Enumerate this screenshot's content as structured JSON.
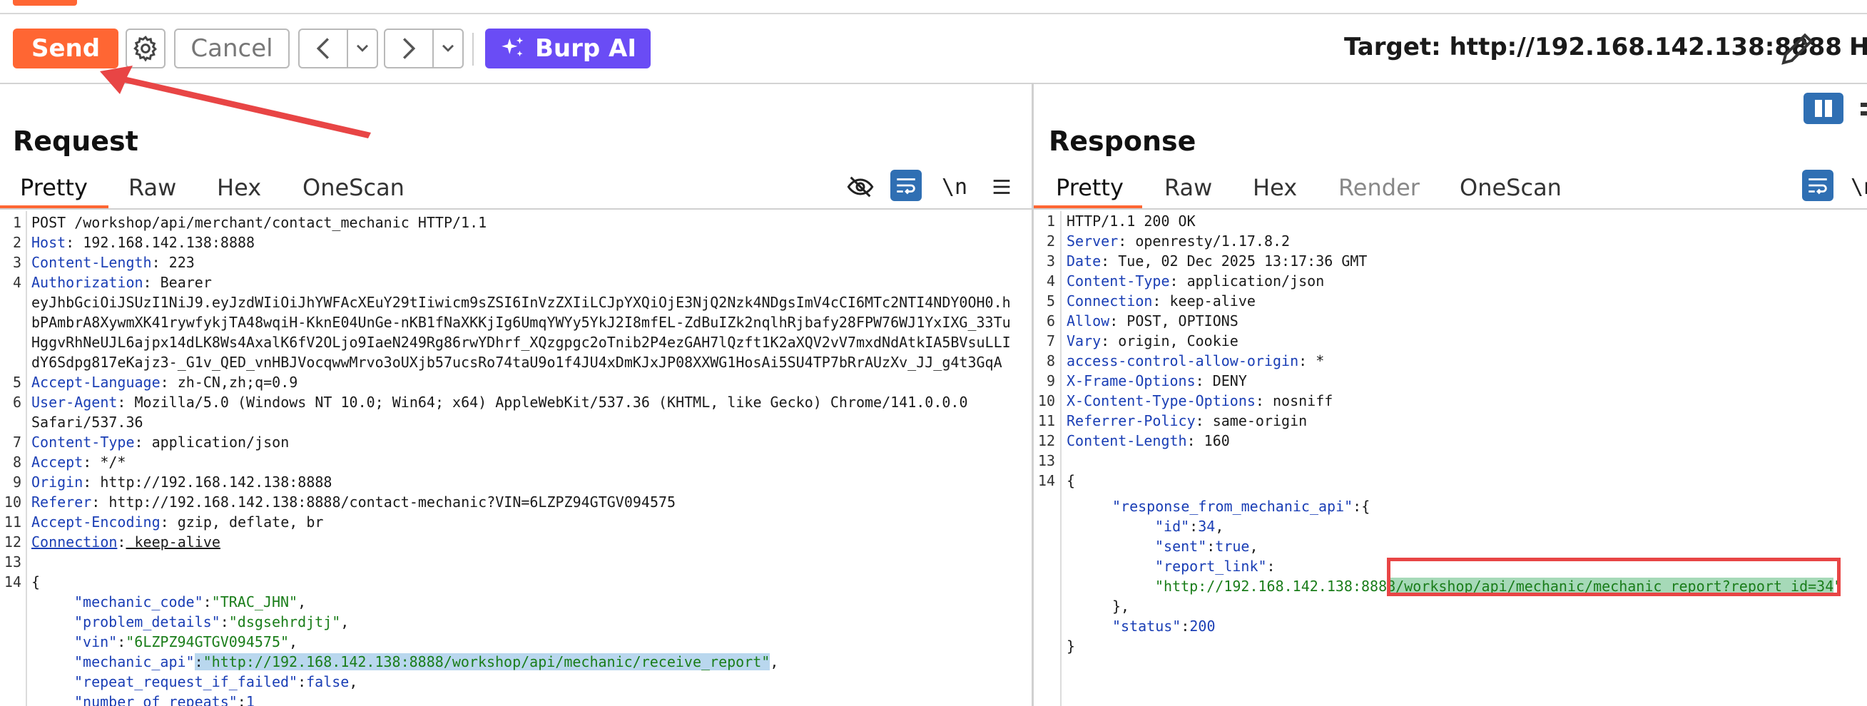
{
  "toolbar": {
    "send_label": "Send",
    "cancel_label": "Cancel",
    "burp_ai_label": "Burp AI",
    "target_label": "Target: http://192.168.142.138:8888",
    "clipped_label": "H"
  },
  "request": {
    "title": "Request",
    "tabs": [
      "Pretty",
      "Raw",
      "Hex",
      "OneScan"
    ],
    "active_tab": "Pretty",
    "lines": [
      {
        "n": "1",
        "text": "POST /workshop/api/merchant/contact_mechanic HTTP/1.1"
      },
      {
        "n": "2",
        "name": "Host",
        "value": " 192.168.142.138:8888"
      },
      {
        "n": "3",
        "name": "Content-Length",
        "value": " 223"
      },
      {
        "n": "4",
        "name": "Authorization",
        "value": " Bearer"
      },
      {
        "n": "",
        "text": "eyJhbGciOiJSUzI1NiJ9.eyJzdWIiOiJhYWFAcXEuY29tIiwicm9sZSI6InVzZXIiLCJpYXQiOjE3NjQ2Nzk4NDgsImV4cCI6MTc2NTI4NDY0OH0.h"
      },
      {
        "n": "",
        "text": "bPAmbrA8XywmXK41rywfykjTA48wqiH-KknE04UnGe-nKB1fNaXKKjIg6UmqYWYy5YkJ2I8mfEL-ZdBuIZk2nqlhRjbafy28FPW76WJ1YxIXG_33Tu"
      },
      {
        "n": "",
        "text": "HggvRhNeUJL6ajpx14dLK8Ws4AxalK6fV2OLjo9IaeN249Rg86rwYDhrf_XQzgpgc2oTnib2P4ezGAH7lQzft1K2aXQV2vV7mxdNdAtkIA5BVsuLLI"
      },
      {
        "n": "",
        "text": "dY6Sdpg817eKajz3-_G1v_QED_vnHBJVocqwwMrvo3oUXjb57ucsRo74taU9o1f4JU4xDmKJxJP08XXWG1HosAi5SU4TP7bRrAUzXv_JJ_g4t3GqA"
      },
      {
        "n": "5",
        "name": "Accept-Language",
        "value": " zh-CN,zh;q=0.9"
      },
      {
        "n": "6",
        "name": "User-Agent",
        "value": " Mozilla/5.0 (Windows NT 10.0; Win64; x64) AppleWebKit/537.36 (KHTML, like Gecko) Chrome/141.0.0.0"
      },
      {
        "n": "",
        "text": "Safari/537.36"
      },
      {
        "n": "7",
        "name": "Content-Type",
        "value": " application/json"
      },
      {
        "n": "8",
        "name": "Accept",
        "value": " */*"
      },
      {
        "n": "9",
        "name": "Origin",
        "value": " http://192.168.142.138:8888"
      },
      {
        "n": "10",
        "name": "Referer",
        "value": " http://192.168.142.138:8888/contact-mechanic?VIN=6LZPZ94GTGV094575"
      },
      {
        "n": "11",
        "name": "Accept-Encoding",
        "value": " gzip, deflate, br"
      },
      {
        "n": "12",
        "name": "Connection",
        "value": " keep-alive"
      },
      {
        "n": "13",
        "text": ""
      },
      {
        "n": "14",
        "text": "{"
      }
    ],
    "json": [
      {
        "key": "\"mechanic_code\"",
        "val": "\"TRAC_JHN\"",
        "type": "s",
        "tail": ","
      },
      {
        "key": "\"problem_details\"",
        "val": "\"dsgsehrdjtj\"",
        "type": "s",
        "tail": ","
      },
      {
        "key": "\"vin\"",
        "val": "\"6LZPZ94GTGV094575\"",
        "type": "s",
        "tail": ","
      },
      {
        "key": "\"mechanic_api\"",
        "val": "\"http://192.168.142.138:8888/workshop/api/mechanic/receive_report\"",
        "type": "s",
        "tail": ","
      },
      {
        "key": "\"repeat_request_if_failed\"",
        "val": "false",
        "type": "n",
        "tail": ","
      },
      {
        "key": "\"number_of_repeats\"",
        "val": "1",
        "type": "n",
        "tail": ""
      }
    ]
  },
  "response": {
    "title": "Response",
    "tabs": [
      "Pretty",
      "Raw",
      "Hex",
      "Render",
      "OneScan"
    ],
    "active_tab": "Pretty",
    "status_line": "HTTP/1.1 200 OK",
    "headers": [
      {
        "n": "2",
        "name": "Server",
        "value": " openresty/1.17.8.2"
      },
      {
        "n": "3",
        "name": "Date",
        "value": " Tue, 02 Dec 2025 13:17:36 GMT"
      },
      {
        "n": "4",
        "name": "Content-Type",
        "value": " application/json"
      },
      {
        "n": "5",
        "name": "Connection",
        "value": " keep-alive"
      },
      {
        "n": "6",
        "name": "Allow",
        "value": " POST, OPTIONS"
      },
      {
        "n": "7",
        "name": "Vary",
        "value": " origin, Cookie"
      },
      {
        "n": "8",
        "name": "access-control-allow-origin",
        "value": " *"
      },
      {
        "n": "9",
        "name": "X-Frame-Options",
        "value": " DENY"
      },
      {
        "n": "10",
        "name": "X-Content-Type-Options",
        "value": " nosniff"
      },
      {
        "n": "11",
        "name": "Referrer-Policy",
        "value": " same-origin"
      },
      {
        "n": "12",
        "name": "Content-Length",
        "value": " 160"
      }
    ],
    "line_13": "",
    "line_14": "{",
    "json": {
      "outer_key": "\"response_from_mechanic_api\"",
      "id_key": "\"id\"",
      "id_val": "34",
      "sent_key": "\"sent\"",
      "sent_val": "true",
      "report_key": "\"report_link\"",
      "report_val_a": "\"http://192.168.142.138:888",
      "report_val_b": "8/workshop/api/mechanic/mechanic_report?report_id=34",
      "report_val_c": "\"",
      "close_inner": "},",
      "status_key": "\"status\"",
      "status_val": "200",
      "close_outer": "}"
    }
  },
  "colors": {
    "accent": "#ff6633",
    "burp_ai": "#6a4cf5",
    "header_name": "#1a3eb5",
    "json_string": "#1a7d1a",
    "highlight": "#b9d7ee",
    "annotation_red": "#e84545"
  }
}
